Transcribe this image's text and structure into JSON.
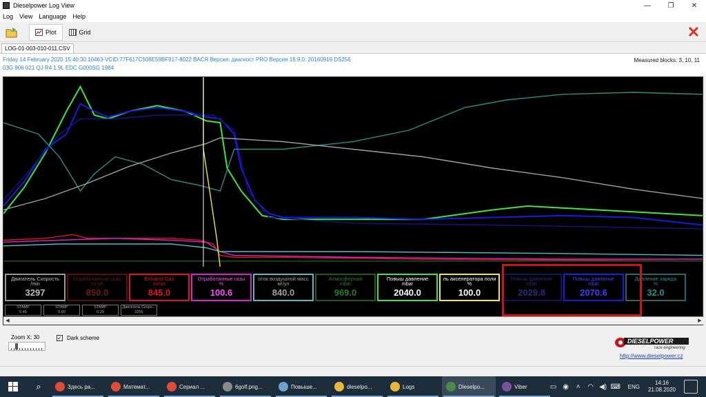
{
  "window": {
    "title": "Dieselpower Log View",
    "controls": {
      "minimize": "—",
      "maximize": "❐",
      "close": "✕"
    }
  },
  "menu": [
    "Log",
    "View",
    "Language",
    "Help"
  ],
  "toolbar": {
    "open_icon": "folder-open-icon",
    "plot_label": "Plot",
    "grid_label": "Grid",
    "close_icon": "red-x-icon",
    "close_glyph": "✕",
    "active_tab": "Plot"
  },
  "file_tab": "LOG-01-003-010-011.CSV",
  "info": {
    "line1": "Friday 14 February 2020 15:40:30:10463-VCID:77F617C506E59BF917-8022 ВАСЯ Версия: диагност PRO Версия 16.9.0: 20160919 DS256",
    "line2": "03G 906 021 QJ  R4 1.9L EDC G000SG  1984",
    "measured_blocks": "Measured blocks: 3, 10, 11"
  },
  "gauges": [
    {
      "label": "Двигатель Скорость",
      "unit": "/min",
      "value": "3297",
      "color": "#9a9a9a",
      "text": "#bfbfbf"
    },
    {
      "label": "Отработанные газы",
      "unit": "mг/ул",
      "value": "850.0",
      "color": "#5a1010",
      "text": "#6f1a1a"
    },
    {
      "label": "Exhaust Gas",
      "unit": "mг/ул",
      "value": "845.0",
      "color": "#e0141e",
      "text": "#e0141e"
    },
    {
      "label": "Отработанные газы",
      "unit": "%",
      "value": "100.6",
      "color": "#d524d0",
      "text": "#ff4dff"
    },
    {
      "label": "оток воздушной масс",
      "unit": "мг/ул",
      "value": "840.0",
      "color": "#4fc0c0",
      "text": "#a0a0a0"
    },
    {
      "label": "Атмосферная",
      "unit": "mbar",
      "value": "969.0",
      "color": "#1f5a1f",
      "text": "#2e7a2e"
    },
    {
      "label": "Повыш давление",
      "unit": "mbar",
      "value": "2040.0",
      "color": "#3fe63f",
      "text": "#ffffff"
    },
    {
      "label": "ль акселератора поли",
      "unit": "%",
      "value": "100.0",
      "color": "#f0f020",
      "text": "#ffffff"
    },
    {
      "label": "Повыш давление",
      "unit": "mbar",
      "value": "2029.8",
      "color": "#14145a",
      "text": "#2a2a7a"
    },
    {
      "label": "Повыш давление",
      "unit": "mbar",
      "value": "2070.6",
      "color": "#1a1ae0",
      "text": "#4040ff"
    },
    {
      "label": "Давление заряда",
      "unit": "%",
      "value": "32.0",
      "color": "#206a6a",
      "text": "#2c8c8c"
    }
  ],
  "stamps": [
    {
      "name": "STAMP",
      "value": "5.45"
    },
    {
      "name": "STAMP",
      "value": "5.60"
    },
    {
      "name": "STAMP",
      "value": "6.29"
    },
    {
      "name": "Двигатель Скоро...",
      "value": "3255"
    }
  ],
  "zoom": {
    "label": "Zoom X: 30",
    "level": 0.15
  },
  "dark_scheme": {
    "label": "Dark scheme",
    "checked": true,
    "mark": "✓"
  },
  "logo": {
    "brand": "DIESELPOWER",
    "tagline": "race engineering",
    "url": "http://www.dieselpower.cz"
  },
  "taskbar": {
    "items": [
      {
        "label": "Здесь ра...",
        "icon": "chrome-icon",
        "color": "#dd4b39"
      },
      {
        "label": "Математ...",
        "icon": "chrome-icon",
        "color": "#dd4b39"
      },
      {
        "label": "Сериал ...",
        "icon": "chrome-icon",
        "color": "#dd4b39"
      },
      {
        "label": "6golf.png...",
        "icon": "photo-viewer-icon",
        "color": "#8a8a8a"
      },
      {
        "label": "Повыше...",
        "icon": "notepad-icon",
        "color": "#6fa0d0"
      },
      {
        "label": "dieselpo...",
        "icon": "folder-icon",
        "color": "#e8b83c"
      },
      {
        "label": "Logs",
        "icon": "folder-icon",
        "color": "#e8b83c"
      },
      {
        "label": "Dieselpo...",
        "icon": "dieselpower-app-icon",
        "color": "#4a8a4a"
      },
      {
        "label": "Viber",
        "icon": "viber-icon",
        "color": "#7b519d"
      }
    ],
    "active_index": 7,
    "lang": "ENG",
    "time": "14:16",
    "date": "21.08.2020"
  },
  "chart_data": {
    "type": "line",
    "x_range": [
      0,
      100
    ],
    "y_range": [
      0,
      100
    ],
    "cursor_x": 28.6,
    "series": [
      {
        "color": "#3fe63f",
        "values": [
          [
            0,
            28
          ],
          [
            3,
            42
          ],
          [
            6,
            60
          ],
          [
            9,
            82
          ],
          [
            11,
            95
          ],
          [
            13,
            80
          ],
          [
            15,
            78
          ],
          [
            18,
            82
          ],
          [
            22,
            85
          ],
          [
            26,
            82
          ],
          [
            29,
            77
          ],
          [
            31,
            76
          ],
          [
            32,
            52
          ],
          [
            34,
            40
          ],
          [
            37,
            27
          ],
          [
            40,
            25
          ],
          [
            50,
            25
          ],
          [
            60,
            25
          ],
          [
            70,
            30
          ],
          [
            75,
            32
          ],
          [
            80,
            31
          ],
          [
            90,
            29
          ],
          [
            100,
            27
          ]
        ]
      },
      {
        "color": "#1a1ae0",
        "values": [
          [
            0,
            32
          ],
          [
            3,
            45
          ],
          [
            6,
            62
          ],
          [
            9,
            70
          ],
          [
            11,
            86
          ],
          [
            13,
            82
          ],
          [
            15,
            79
          ],
          [
            18,
            82
          ],
          [
            22,
            84
          ],
          [
            26,
            82
          ],
          [
            29,
            79
          ],
          [
            31,
            78
          ],
          [
            33,
            70
          ],
          [
            34,
            52
          ],
          [
            36,
            35
          ],
          [
            38,
            28
          ],
          [
            40,
            26
          ],
          [
            50,
            26
          ],
          [
            60,
            25
          ],
          [
            70,
            26
          ],
          [
            80,
            27
          ],
          [
            90,
            26
          ],
          [
            100,
            22
          ]
        ]
      },
      {
        "color": "#14148a",
        "values": [
          [
            0,
            35
          ],
          [
            4,
            52
          ],
          [
            8,
            70
          ],
          [
            11,
            78
          ],
          [
            16,
            78
          ],
          [
            22,
            80
          ],
          [
            27,
            80
          ],
          [
            30,
            80
          ],
          [
            33,
            72
          ],
          [
            35,
            40
          ],
          [
            38,
            26
          ],
          [
            50,
            23
          ],
          [
            70,
            22
          ],
          [
            100,
            20
          ]
        ]
      },
      {
        "color": "#2c8c8c",
        "values": [
          [
            0,
            76
          ],
          [
            5,
            70
          ],
          [
            8,
            58
          ],
          [
            11,
            40
          ],
          [
            13,
            49
          ],
          [
            16,
            58
          ],
          [
            20,
            54
          ],
          [
            24,
            46
          ],
          [
            28,
            43
          ],
          [
            31,
            40
          ],
          [
            33,
            62
          ],
          [
            36,
            62
          ],
          [
            40,
            62
          ],
          [
            50,
            66
          ],
          [
            58,
            72
          ],
          [
            66,
            84
          ],
          [
            72,
            88
          ],
          [
            80,
            91
          ],
          [
            90,
            92
          ],
          [
            100,
            91
          ]
        ]
      },
      {
        "color": "#a0a0a0",
        "values": [
          [
            0,
            30
          ],
          [
            6,
            36
          ],
          [
            12,
            44
          ],
          [
            18,
            53
          ],
          [
            24,
            60
          ],
          [
            29,
            65
          ],
          [
            31,
            68
          ],
          [
            40,
            66
          ],
          [
            50,
            62
          ],
          [
            60,
            58
          ],
          [
            70,
            52
          ],
          [
            80,
            47
          ],
          [
            90,
            41
          ],
          [
            100,
            36
          ]
        ]
      },
      {
        "color": "#e0141e",
        "values": [
          [
            0,
            14
          ],
          [
            6,
            15
          ],
          [
            10,
            17
          ],
          [
            12,
            15
          ],
          [
            15,
            15
          ],
          [
            24,
            15
          ],
          [
            28,
            14
          ],
          [
            30,
            12
          ],
          [
            31,
            6
          ],
          [
            33,
            5
          ],
          [
            40,
            5
          ],
          [
            60,
            4
          ],
          [
            100,
            3
          ]
        ]
      },
      {
        "color": "#d524d0",
        "values": [
          [
            0,
            13
          ],
          [
            8,
            14
          ],
          [
            16,
            15
          ],
          [
            24,
            14
          ],
          [
            29,
            13
          ],
          [
            31,
            8
          ],
          [
            33,
            6
          ],
          [
            50,
            5
          ],
          [
            80,
            4
          ],
          [
            100,
            4
          ]
        ]
      },
      {
        "color": "#4fc0c0",
        "values": [
          [
            0,
            11
          ],
          [
            8,
            12
          ],
          [
            16,
            12
          ],
          [
            24,
            12
          ],
          [
            29,
            10
          ],
          [
            31,
            8
          ],
          [
            33,
            8
          ],
          [
            50,
            8
          ],
          [
            80,
            7
          ],
          [
            100,
            6
          ]
        ]
      },
      {
        "color": "#1f5a1f",
        "values": [
          [
            0,
            3
          ],
          [
            50,
            3
          ],
          [
            100,
            3
          ]
        ]
      },
      {
        "color": "#f0f020",
        "values": [
          [
            28.6,
            100
          ],
          [
            28.6,
            62
          ],
          [
            29.5,
            40
          ],
          [
            30.5,
            15
          ],
          [
            31,
            0
          ]
        ]
      }
    ]
  }
}
